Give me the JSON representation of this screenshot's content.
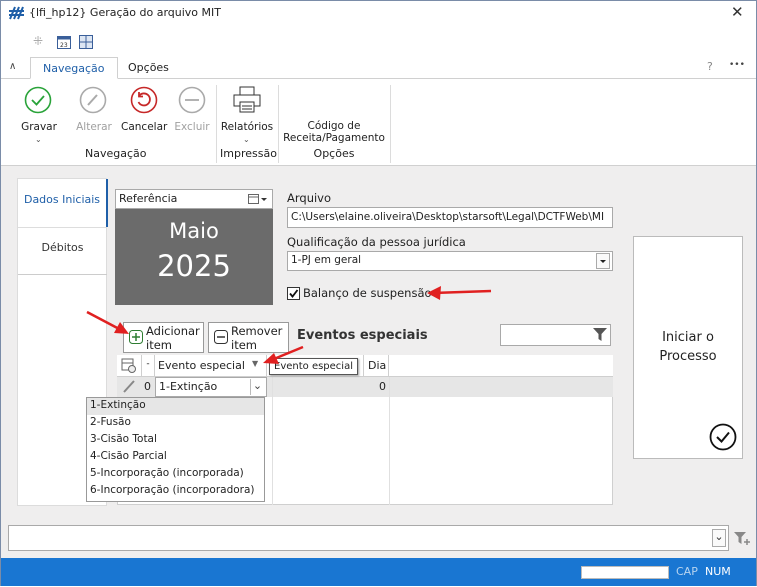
{
  "window": {
    "title": "{lfi_hp12}  Geração do arquivo MIT"
  },
  "ribbon_tabs": [
    "Navegação",
    "Opções"
  ],
  "help_label": "?",
  "more_label": "•••",
  "ribbon": {
    "gravar": "Gravar",
    "alterar": "Alterar",
    "cancelar": "Cancelar",
    "excluir": "Excluir",
    "relatorios": "Relatórios",
    "codigo_receita_1": "Código de",
    "codigo_receita_2": "Receita/Pagamento",
    "group_navegacao": "Navegação",
    "group_impressao": "Impressão",
    "group_opcoes": "Opções"
  },
  "sidebar": {
    "items": [
      "Dados Iniciais",
      "Débitos"
    ]
  },
  "referencia": {
    "label": "Referência",
    "month": "Maio",
    "year": "2025"
  },
  "arquivo": {
    "label": "Arquivo",
    "value": "C:\\Users\\elaine.oliveira\\Desktop\\starsoft\\Legal\\DCTFWeb\\MI"
  },
  "qualificacao": {
    "label": "Qualificação da pessoa jurídica",
    "value": "1-PJ em geral"
  },
  "balanco": {
    "label": "Balanço de suspensão",
    "checked": true
  },
  "buttons": {
    "adicionar_1": "Adicionar",
    "adicionar_2": "item",
    "remover_1": "Remover",
    "remover_2": "item"
  },
  "eventos": {
    "title": "Eventos especiais",
    "col_evento": "Evento especial",
    "col_dia": "Dia",
    "tooltip": "Evento especial",
    "row": {
      "index": "0",
      "evento": "1-Extinção",
      "dia": "0"
    },
    "options": [
      "1-Extinção",
      "2-Fusão",
      "3-Cisão Total",
      "4-Cisão Parcial",
      "5-Incorporação (incorporada)",
      "6-Incorporação (incorporadora)"
    ]
  },
  "iniciar": {
    "line1": "Iniciar o",
    "line2": "Processo"
  },
  "status": {
    "cap": "CAP",
    "num": "NUM"
  }
}
